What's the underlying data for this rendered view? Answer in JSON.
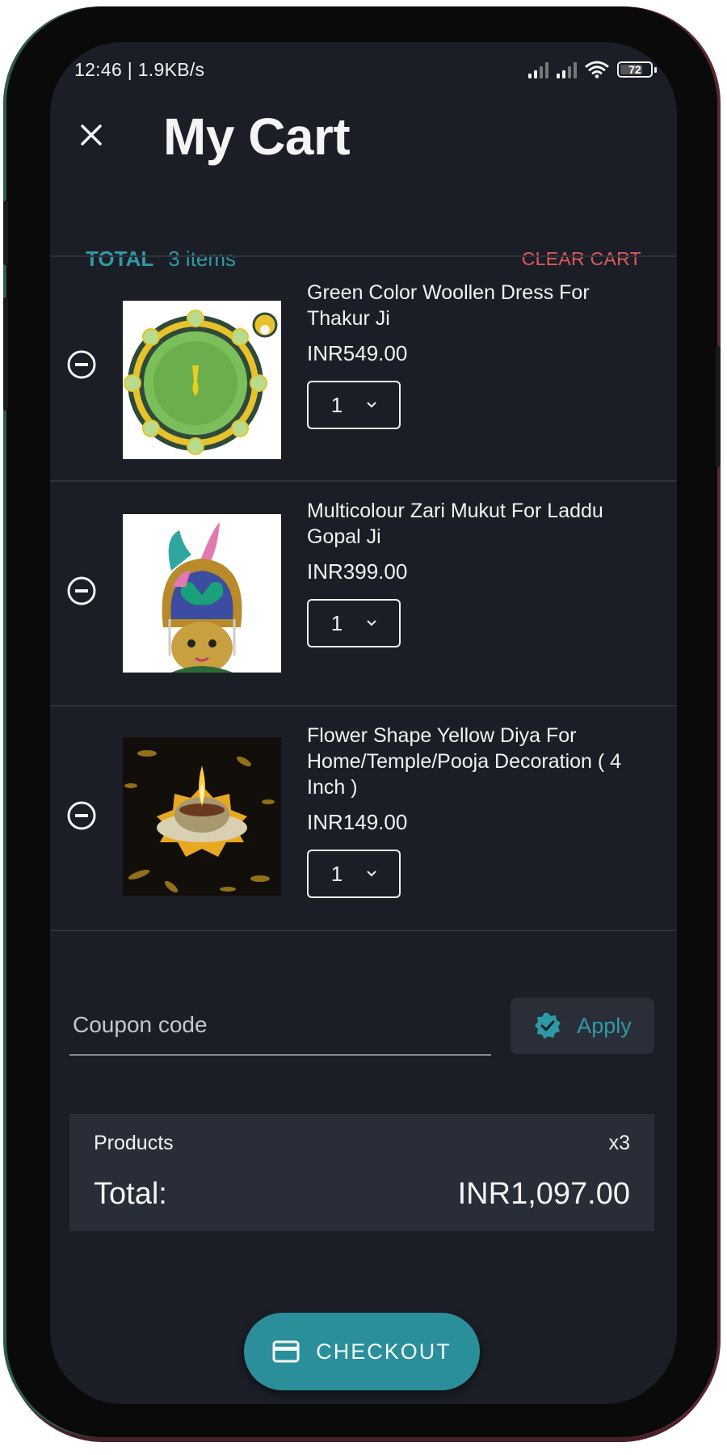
{
  "status_bar": {
    "time_speed": "12:46 | 1.9KB/s",
    "battery_level": "72",
    "icons": [
      "signal-icon",
      "signal-icon",
      "wifi-icon",
      "battery-icon"
    ]
  },
  "header": {
    "close_icon": "close-icon",
    "title": "My Cart"
  },
  "summary_bar": {
    "total_label": "TOTAL",
    "item_count": "3 items",
    "clear_label": "CLEAR CART"
  },
  "colors": {
    "accent": "#2f9aa6",
    "danger": "#e05a5a",
    "background": "#1b1e26",
    "checkout": "#2a8f9a"
  },
  "items": [
    {
      "name": "Green Color Woollen Dress For Thakur Ji",
      "price": "INR549.00",
      "quantity": "1",
      "image": "green-woollen-dress-image"
    },
    {
      "name": "Multicolour Zari Mukut For Laddu Gopal Ji",
      "price": "INR399.00",
      "quantity": "1",
      "image": "zari-mukut-image"
    },
    {
      "name": "Flower Shape Yellow Diya For Home/Temple/Pooja Decoration ( 4 Inch )",
      "price": "INR149.00",
      "quantity": "1",
      "image": "flower-diya-image"
    }
  ],
  "coupon": {
    "placeholder": "Coupon code",
    "value": "",
    "apply_label": "Apply"
  },
  "order_summary": {
    "products_label": "Products",
    "products_count": "x3",
    "total_label": "Total:",
    "total_value": "INR1,097.00"
  },
  "checkout": {
    "label": "CHECKOUT",
    "icon": "credit-card-icon"
  }
}
